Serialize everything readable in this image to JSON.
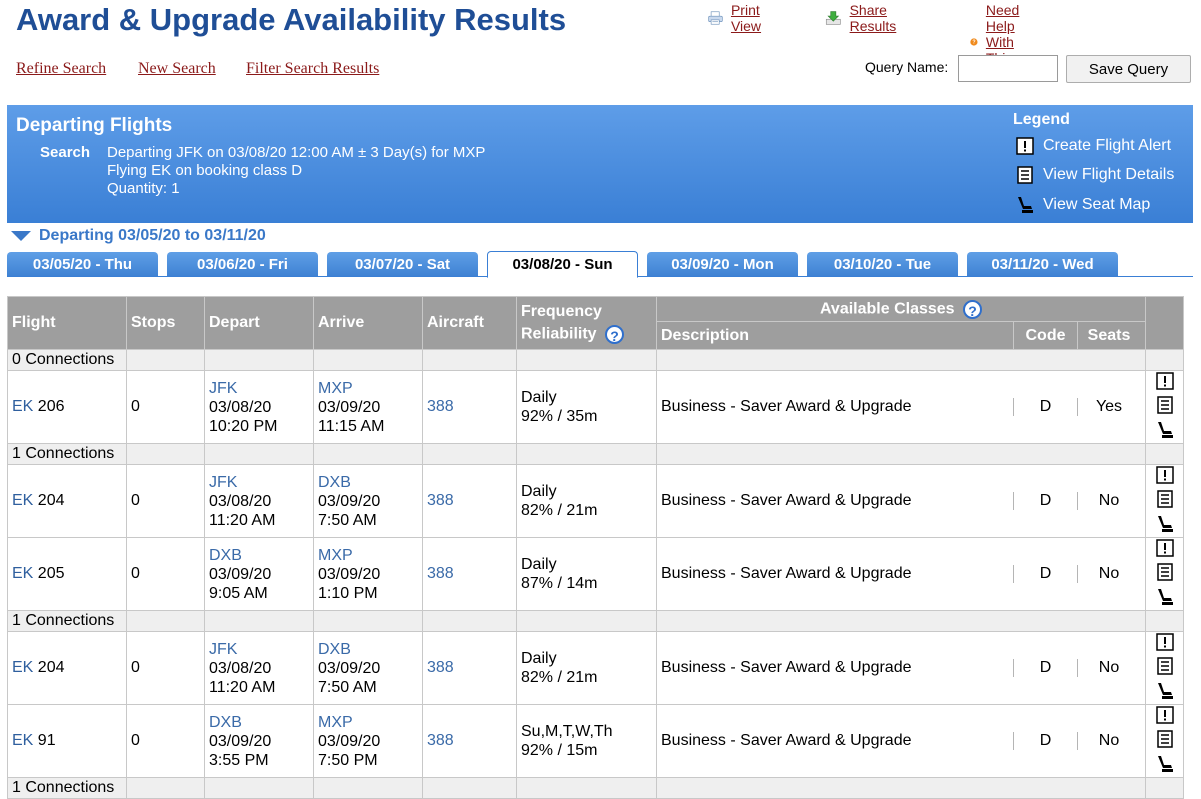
{
  "page_title": "Award & Upgrade Availability Results",
  "top_links": {
    "print": "Print View",
    "share": "Share Results",
    "help": "Need Help With This Page?"
  },
  "nav_links": {
    "refine": "Refine Search",
    "new": "New Search",
    "filter": "Filter Search Results"
  },
  "query": {
    "label": "Query Name:",
    "value": "",
    "placeholder": "",
    "save_label": "Save Query"
  },
  "banner": {
    "title": "Departing Flights",
    "search_label": "Search",
    "line1": "Departing JFK on 03/08/20 12:00 AM ± 3 Day(s) for MXP",
    "line2": "Flying EK on booking class D",
    "line3": "Quantity: 1",
    "legend_title": "Legend",
    "legend": [
      "Create Flight Alert",
      "View Flight Details",
      "View Seat Map"
    ]
  },
  "departing_range": "Departing 03/05/20 to 03/11/20",
  "tabs": [
    "03/05/20 - Thu",
    "03/06/20 - Fri",
    "03/07/20 - Sat",
    "03/08/20 - Sun",
    "03/09/20 - Mon",
    "03/10/20 - Tue",
    "03/11/20 - Wed"
  ],
  "active_tab": 3,
  "table": {
    "headers": {
      "flight": "Flight",
      "stops": "Stops",
      "depart": "Depart",
      "arrive": "Arrive",
      "aircraft": "Aircraft",
      "frequency": "Frequency",
      "reliability": "Reliability",
      "available_classes": "Available Classes",
      "description": "Description",
      "code": "Code",
      "seats": "Seats"
    },
    "groups": [
      {
        "label": "0 Connections",
        "flights": [
          {
            "airline": "EK",
            "number": "206",
            "stops": "0",
            "dep_code": "JFK",
            "dep_date": "03/08/20",
            "dep_time": "10:20 PM",
            "arr_code": "MXP",
            "arr_date": "03/09/20",
            "arr_time": "11:15 AM",
            "aircraft": "388",
            "frequency": "Daily",
            "reliability": "92% / 35m",
            "description": "Business - Saver Award & Upgrade",
            "code": "D",
            "seats": "Yes"
          }
        ]
      },
      {
        "label": "1 Connections",
        "flights": [
          {
            "airline": "EK",
            "number": "204",
            "stops": "0",
            "dep_code": "JFK",
            "dep_date": "03/08/20",
            "dep_time": "11:20 AM",
            "arr_code": "DXB",
            "arr_date": "03/09/20",
            "arr_time": "7:50 AM",
            "aircraft": "388",
            "frequency": "Daily",
            "reliability": "82% / 21m",
            "description": "Business - Saver Award & Upgrade",
            "code": "D",
            "seats": "No"
          },
          {
            "airline": "EK",
            "number": "205",
            "stops": "0",
            "dep_code": "DXB",
            "dep_date": "03/09/20",
            "dep_time": "9:05 AM",
            "arr_code": "MXP",
            "arr_date": "03/09/20",
            "arr_time": "1:10 PM",
            "aircraft": "388",
            "frequency": "Daily",
            "reliability": "87% / 14m",
            "description": "Business - Saver Award & Upgrade",
            "code": "D",
            "seats": "No"
          }
        ]
      },
      {
        "label": "1 Connections",
        "flights": [
          {
            "airline": "EK",
            "number": "204",
            "stops": "0",
            "dep_code": "JFK",
            "dep_date": "03/08/20",
            "dep_time": "11:20 AM",
            "arr_code": "DXB",
            "arr_date": "03/09/20",
            "arr_time": "7:50 AM",
            "aircraft": "388",
            "frequency": "Daily",
            "reliability": "82% / 21m",
            "description": "Business - Saver Award & Upgrade",
            "code": "D",
            "seats": "No"
          },
          {
            "airline": "EK",
            "number": "91",
            "stops": "0",
            "dep_code": "DXB",
            "dep_date": "03/09/20",
            "dep_time": "3:55 PM",
            "arr_code": "MXP",
            "arr_date": "03/09/20",
            "arr_time": "7:50 PM",
            "aircraft": "388",
            "frequency": "Su,M,T,W,Th",
            "reliability": "92% / 15m",
            "description": "Business - Saver Award & Upgrade",
            "code": "D",
            "seats": "No"
          }
        ]
      },
      {
        "label": "1 Connections",
        "flights": []
      }
    ]
  },
  "colors": {
    "title": "#1f4e96",
    "link": "#8b1a1a",
    "banner": "#3a7fd5",
    "header": "#9e9e9e"
  }
}
